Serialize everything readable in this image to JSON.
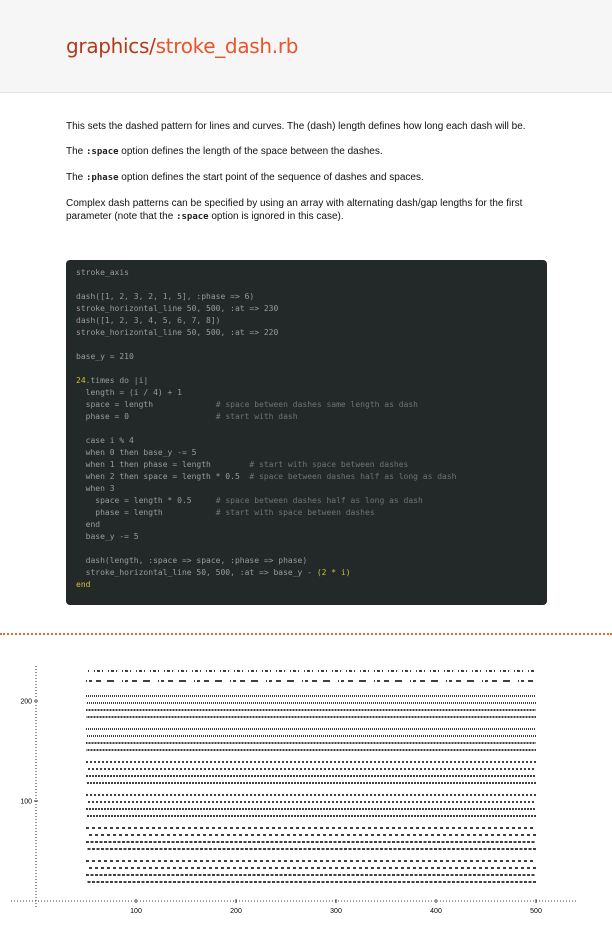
{
  "header": {
    "title_dir": "graphics/",
    "title_file": "stroke_dash.rb"
  },
  "description": {
    "p1": "This sets the dashed pattern for lines and curves. The (dash) length defines how long each dash will be.",
    "p2_before": "The ",
    "p2_code": ":space",
    "p2_after": " option defines the length of the space between the dashes.",
    "p3_before": "The ",
    "p3_code": ":phase",
    "p3_after": " option defines the start point of the sequence of dashes and spaces.",
    "p4_before": "Complex dash patterns can be specified by using an array with alternating dash/gap lengths for the first parameter (note that the ",
    "p4_code": ":space",
    "p4_after": " option is ignored in this case)."
  },
  "code": {
    "l1": "stroke_axis",
    "l2": "dash([1, 2, 3, 2, 1, 5], :phase => 6)",
    "l3": "stroke_horizontal_line 50, 500, :at => 230",
    "l4": "dash([1, 2, 3, 4, 5, 6, 7, 8])",
    "l5": "stroke_horizontal_line 50, 500, :at => 220",
    "l6": "base_y = 210",
    "l7_num": "24",
    "l7_rest": ".times do |i|",
    "l8": "  length = (i / 4) + 1",
    "l9_code": "  space = length             ",
    "l9_comment": "# space between dashes same length as dash",
    "l10_code": "  phase = 0                  ",
    "l10_comment": "# start with dash",
    "l11": "  case i % 4",
    "l12": "  when 0 then base_y -= 5",
    "l13_code": "  when 1 then phase = length        ",
    "l13_comment": "# start with space between dashes",
    "l14_code": "  when 2 then space = length * 0.5  ",
    "l14_comment": "# space between dashes half as long as dash",
    "l15": "  when 3",
    "l16_code": "    space = length * 0.5     ",
    "l16_comment": "# space between dashes half as long as dash",
    "l17_code": "    phase = length           ",
    "l17_comment": "# start with space between dashes",
    "l18": "  end",
    "l19": "  base_y -= 5",
    "l20": "  dash(length, :space => space, :phase => phase)",
    "l21_code": "  stroke_horizontal_line 50, 500, :at => base_y - ",
    "l21_num": "(2 * i)",
    "l22": "end"
  },
  "chart_data": {
    "type": "line",
    "title": "",
    "xlabel": "",
    "ylabel": "",
    "x_ticks": [
      "100",
      "200",
      "300",
      "400",
      "500"
    ],
    "y_ticks": [
      "100",
      "200"
    ],
    "xlim": [
      0,
      540
    ],
    "ylim": [
      0,
      235
    ],
    "series": [
      {
        "x": [
          50,
          500
        ],
        "y": [
          230,
          230
        ],
        "dash": [
          1,
          2,
          3,
          2,
          1,
          5
        ],
        "phase": 6
      },
      {
        "x": [
          50,
          500
        ],
        "y": [
          220,
          220
        ],
        "dash": [
          1,
          2,
          3,
          4,
          5,
          6,
          7,
          8
        ],
        "phase": 0
      },
      {
        "x": [
          50,
          500
        ],
        "y": [
          205,
          205
        ],
        "dash": [
          1,
          1
        ],
        "phase": 0
      },
      {
        "x": [
          50,
          500
        ],
        "y": [
          198,
          198
        ],
        "dash": [
          1,
          1
        ],
        "phase": 1
      },
      {
        "x": [
          50,
          500
        ],
        "y": [
          191,
          191
        ],
        "dash": [
          1,
          0.5
        ],
        "phase": 0
      },
      {
        "x": [
          50,
          500
        ],
        "y": [
          184,
          184
        ],
        "dash": [
          1,
          0.5
        ],
        "phase": 1
      },
      {
        "x": [
          50,
          500
        ],
        "y": [
          172,
          172
        ],
        "dash": [
          1,
          1
        ],
        "phase": 0
      },
      {
        "x": [
          50,
          500
        ],
        "y": [
          165,
          165
        ],
        "dash": [
          1,
          1
        ],
        "phase": 1
      },
      {
        "x": [
          50,
          500
        ],
        "y": [
          158,
          158
        ],
        "dash": [
          1,
          0.5
        ],
        "phase": 0
      },
      {
        "x": [
          50,
          500
        ],
        "y": [
          151,
          151
        ],
        "dash": [
          1,
          0.5
        ],
        "phase": 1
      },
      {
        "x": [
          50,
          500
        ],
        "y": [
          139,
          139
        ],
        "dash": [
          2,
          2
        ],
        "phase": 0
      },
      {
        "x": [
          50,
          500
        ],
        "y": [
          132,
          132
        ],
        "dash": [
          2,
          2
        ],
        "phase": 2
      },
      {
        "x": [
          50,
          500
        ],
        "y": [
          125,
          125
        ],
        "dash": [
          2,
          1
        ],
        "phase": 0
      },
      {
        "x": [
          50,
          500
        ],
        "y": [
          118,
          118
        ],
        "dash": [
          2,
          1
        ],
        "phase": 2
      },
      {
        "x": [
          50,
          500
        ],
        "y": [
          106,
          106
        ],
        "dash": [
          2,
          2
        ],
        "phase": 0
      },
      {
        "x": [
          50,
          500
        ],
        "y": [
          99,
          99
        ],
        "dash": [
          2,
          2
        ],
        "phase": 2
      },
      {
        "x": [
          50,
          500
        ],
        "y": [
          92,
          92
        ],
        "dash": [
          2,
          1
        ],
        "phase": 0
      },
      {
        "x": [
          50,
          500
        ],
        "y": [
          85,
          85
        ],
        "dash": [
          2,
          1
        ],
        "phase": 2
      },
      {
        "x": [
          50,
          500
        ],
        "y": [
          73,
          73
        ],
        "dash": [
          3,
          3
        ],
        "phase": 0
      },
      {
        "x": [
          50,
          500
        ],
        "y": [
          66,
          66
        ],
        "dash": [
          3,
          3
        ],
        "phase": 3
      },
      {
        "x": [
          50,
          500
        ],
        "y": [
          59,
          59
        ],
        "dash": [
          3,
          1.5
        ],
        "phase": 0
      },
      {
        "x": [
          50,
          500
        ],
        "y": [
          52,
          52
        ],
        "dash": [
          3,
          1.5
        ],
        "phase": 3
      },
      {
        "x": [
          50,
          500
        ],
        "y": [
          40,
          40
        ],
        "dash": [
          3,
          3
        ],
        "phase": 0
      },
      {
        "x": [
          50,
          500
        ],
        "y": [
          33,
          33
        ],
        "dash": [
          3,
          3
        ],
        "phase": 3
      },
      {
        "x": [
          50,
          500
        ],
        "y": [
          26,
          26
        ],
        "dash": [
          3,
          1.5
        ],
        "phase": 0
      },
      {
        "x": [
          50,
          500
        ],
        "y": [
          19,
          19
        ],
        "dash": [
          3,
          1.5
        ],
        "phase": 3
      }
    ]
  }
}
